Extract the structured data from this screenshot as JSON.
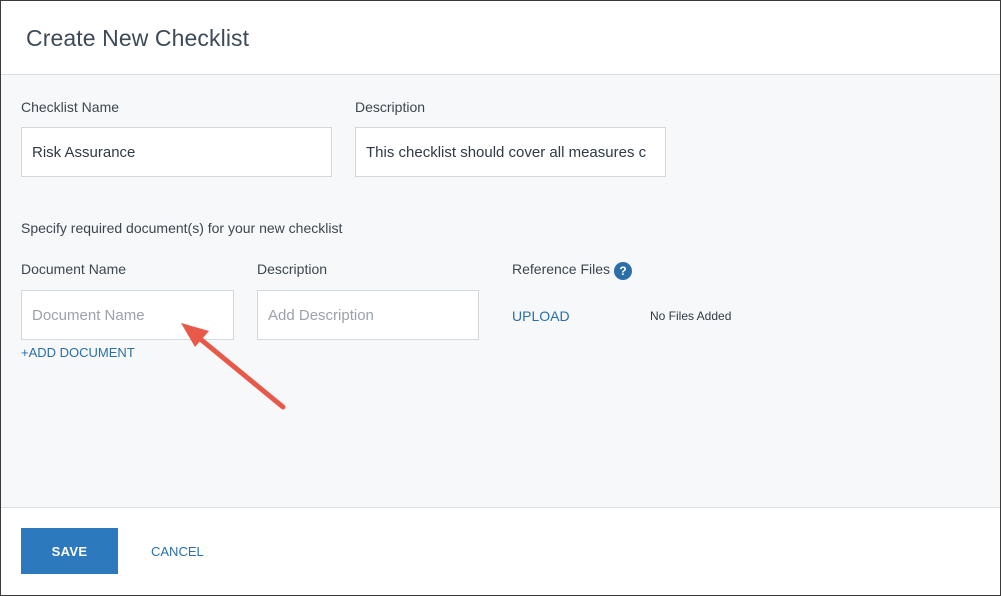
{
  "dialog": {
    "title": "Create New Checklist"
  },
  "checklist": {
    "name_label": "Checklist Name",
    "name_value": "Risk Assurance",
    "description_label": "Description",
    "description_value": "This checklist should cover all measures c"
  },
  "documents": {
    "instructions": "Specify required document(s) for your new checklist",
    "doc_name_label": "Document Name",
    "doc_name_placeholder": "Document Name",
    "description_label": "Description",
    "description_placeholder": "Add Description",
    "reference_files_label": "Reference Files",
    "help_glyph": "?",
    "upload_label": "UPLOAD",
    "no_files_text": "No Files Added",
    "add_document_label": "+ADD DOCUMENT"
  },
  "footer": {
    "save_label": "SAVE",
    "cancel_label": "CANCEL"
  },
  "colors": {
    "accent": "#2c79bd",
    "annotation_arrow": "#e8594a"
  },
  "icons": {
    "help": "question-circle-icon",
    "annotation": "arrow-annotation-icon"
  }
}
